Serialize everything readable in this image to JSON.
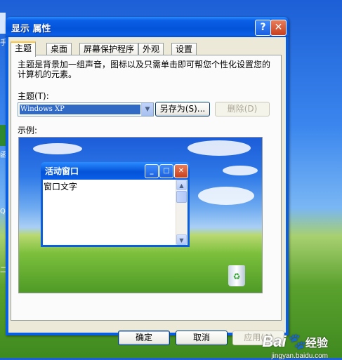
{
  "window": {
    "title": "显示 属性",
    "help_button": "?",
    "close_button": "✕"
  },
  "tabs": [
    {
      "label": "主题",
      "active": true
    },
    {
      "label": "桌面",
      "active": false
    },
    {
      "label": "屏幕保护程序",
      "active": false
    },
    {
      "label": "外观",
      "active": false
    },
    {
      "label": "设置",
      "active": false
    }
  ],
  "themes_panel": {
    "description": "主题是背景加一组声音，图标以及只需单击即可帮您个性化设置您的计算机的元素。",
    "theme_label": "主题(T):",
    "theme_value": "Windows XP",
    "save_as_button": "另存为(S)...",
    "delete_button": "删除(D)",
    "preview_label": "示例:"
  },
  "preview_window": {
    "title": "活动窗口",
    "body_text": "窗口文字"
  },
  "buttons": {
    "ok": "确定",
    "cancel": "取消",
    "apply": "应用(A)"
  },
  "watermark": {
    "brand": "Bai",
    "brand_cn": "经验",
    "url": "jingyan.baidu.com"
  },
  "desktop_fragments": [
    "手",
    "函",
    "Q",
    "二"
  ],
  "colors": {
    "titlebar": "#0a5fe0",
    "dialog_bg": "#ece9d8",
    "tab_highlight": "#ffc83c",
    "selection": "#316ac5",
    "close_button": "#c8401e"
  }
}
